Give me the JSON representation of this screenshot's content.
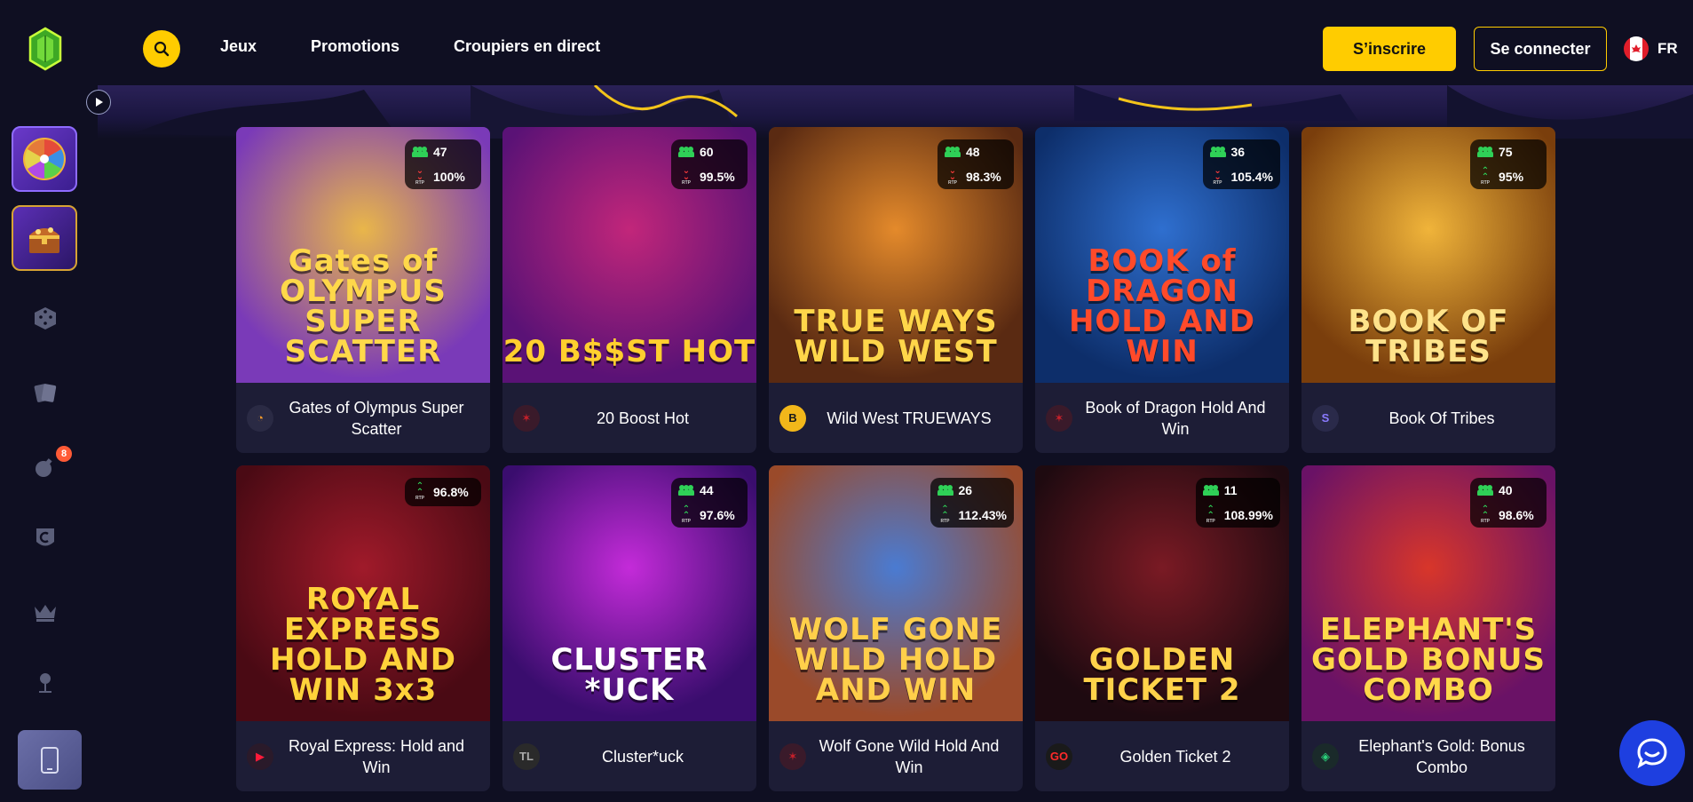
{
  "header": {
    "logo_icon": "emerald-gem-icon",
    "search_icon": "search-icon",
    "nav": [
      "Jeux",
      "Promotions",
      "Croupiers en direct"
    ],
    "signup_label": "S’inscrire",
    "login_label": "Se connecter",
    "language": "FR",
    "flag_icon": "canada-flag-icon"
  },
  "sidebar": {
    "toggle_icon": "play-icon",
    "items": [
      "wheel-of-fortune-icon",
      "treasure-chest-icon",
      "dice-icon",
      "cards-icon",
      "bomb-icon",
      "shield-icon",
      "crown-icon",
      "microphone-icon",
      "mobile-icon"
    ],
    "bomb_badge": "8"
  },
  "games": [
    {
      "name": "Gates of Olympus Super Scatter",
      "players": "47",
      "rtp": "100%",
      "trend": "down",
      "provider": "pragmatic",
      "art": "Gates of OLYMPUS SUPER SCATTER",
      "c1": "#e9b64a",
      "c2": "#7a3ab8",
      "title_color": "#ffd84a"
    },
    {
      "name": "20 Boost Hot",
      "players": "60",
      "rtp": "99.5%",
      "trend": "down",
      "provider": "amusnet",
      "art": "20 B$$ST HOT",
      "c1": "#c2267a",
      "c2": "#5a1276",
      "title_color": "#ffcf2e"
    },
    {
      "name": "Wild West TRUEWAYS",
      "players": "48",
      "rtp": "98.3%",
      "trend": "down",
      "provider": "bgaming",
      "art": "TRUE WAYS WILD WEST",
      "c1": "#e48a2b",
      "c2": "#5a2a12",
      "title_color": "#ffd64a"
    },
    {
      "name": "Book of Dragon Hold And Win",
      "players": "36",
      "rtp": "105.4%",
      "trend": "down",
      "provider": "amusnet",
      "art": "BOOK of DRAGON HOLD AND WIN",
      "c1": "#2f6fcf",
      "c2": "#0d2e6a",
      "title_color": "#ff4a2a"
    },
    {
      "name": "Book Of Tribes",
      "players": "75",
      "rtp": "95%",
      "trend": "up",
      "provider": "spinomenal",
      "art": "BOOK OF TRIBES",
      "c1": "#f0b43a",
      "c2": "#7a3e0c",
      "title_color": "#ffe38a"
    },
    {
      "name": "Royal Express: Hold and Win",
      "players": "",
      "rtp": "96.8%",
      "trend": "up",
      "provider": "playson",
      "art": "ROYAL EXPRESS HOLD AND WIN 3x3",
      "c1": "#a01a2a",
      "c2": "#4a0a14",
      "title_color": "#ffd23a"
    },
    {
      "name": "Cluster*uck",
      "players": "44",
      "rtp": "97.6%",
      "trend": "up",
      "provider": "truelab",
      "art": "CLUSTER *UCK",
      "c1": "#c42bd9",
      "c2": "#3a0d6e",
      "title_color": "#ffffff"
    },
    {
      "name": "Wolf Gone Wild Hold And Win",
      "players": "26",
      "rtp": "112.43%",
      "trend": "up",
      "provider": "amusnet",
      "art": "WOLF GONE WILD HOLD AND WIN",
      "c1": "#4a7bd2",
      "c2": "#9a4a2a",
      "title_color": "#ffcf4a"
    },
    {
      "name": "Golden Ticket 2",
      "players": "11",
      "rtp": "108.99%",
      "trend": "up",
      "provider": "playngo",
      "art": "GOLDEN TICKET 2",
      "c1": "#7a1a24",
      "c2": "#1e0a10",
      "title_color": "#ffd24a"
    },
    {
      "name": "Elephant's Gold: Bonus Combo",
      "players": "40",
      "rtp": "98.6%",
      "trend": "up",
      "provider": "booming",
      "art": "ELEPHANT'S GOLD BONUS COMBO",
      "c1": "#d8362a",
      "c2": "#6a1266",
      "title_color": "#ffd84a"
    }
  ],
  "chat_icon": "chat-bubble-icon",
  "colors": {
    "accent": "#ffcc00",
    "background": "#0f0f22",
    "card": "#1d1d36",
    "chat": "#1e3fe0"
  }
}
